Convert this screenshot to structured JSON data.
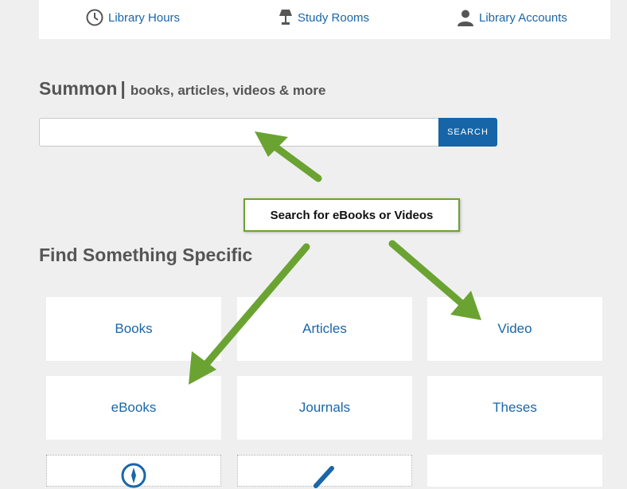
{
  "topbar": {
    "hours": "Library Hours",
    "rooms": "Study Rooms",
    "accounts": "Library Accounts"
  },
  "summon": {
    "title": "Summon",
    "separator": "|",
    "subtitle": "books, articles, videos & more",
    "search_value": "",
    "search_button": "SEARCH"
  },
  "callout": "Search for eBooks or Videos",
  "section_title": "Find Something Specific",
  "tiles": {
    "books": "Books",
    "articles": "Articles",
    "video": "Video",
    "ebooks": "eBooks",
    "journals": "Journals",
    "theses": "Theses"
  },
  "colors": {
    "link": "#1a66a8",
    "button": "#1565a8",
    "arrow": "#6aa332",
    "heading": "#555555"
  }
}
